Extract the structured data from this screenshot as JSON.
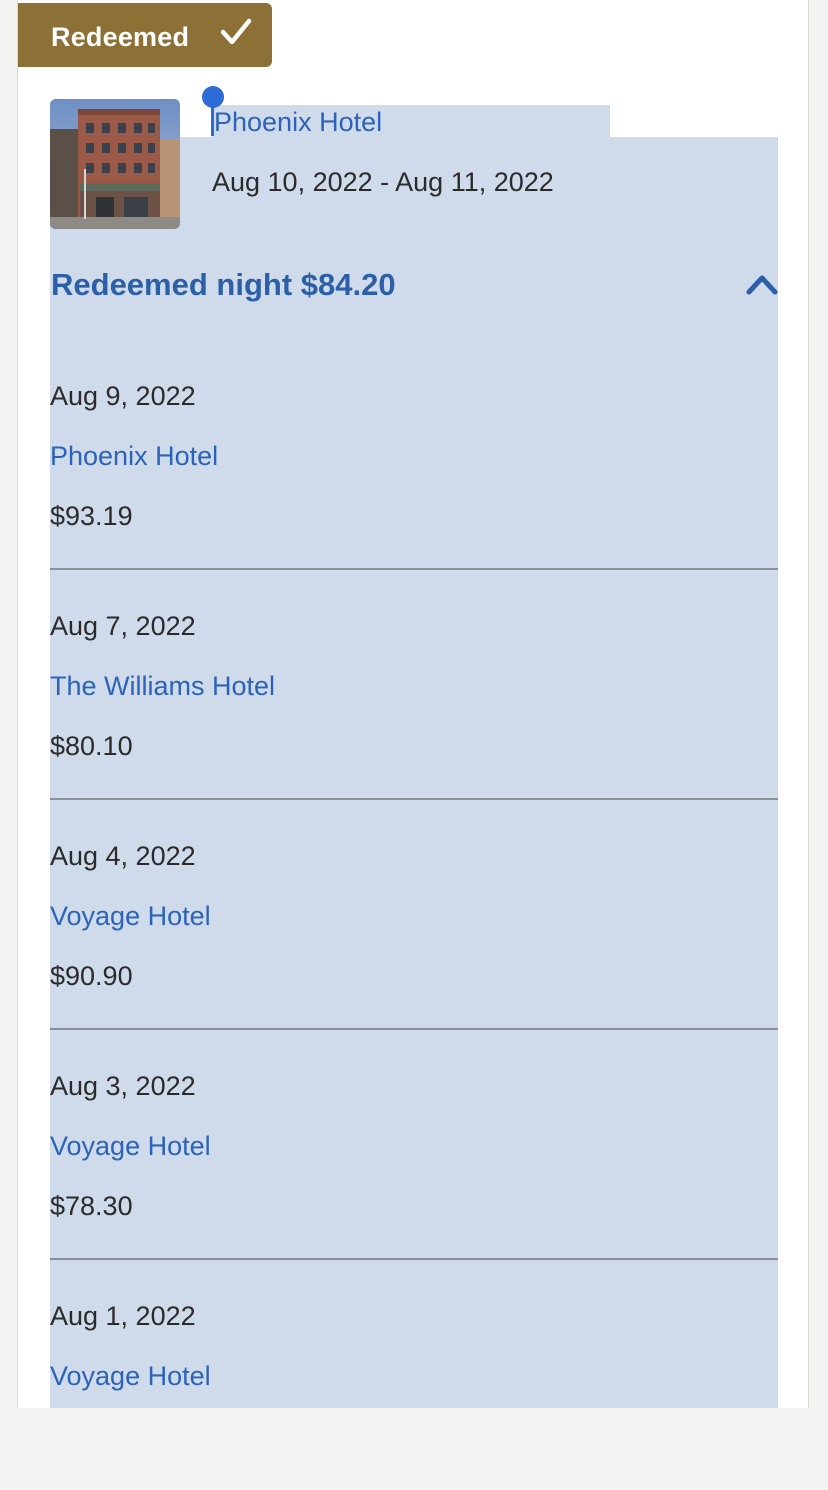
{
  "badge": {
    "label": "Redeemed",
    "icon": "check-icon",
    "color": "#8d7035"
  },
  "stay": {
    "hotel_name": "Phoenix Hotel",
    "dates": "Aug 10, 2022 - Aug 11, 2022",
    "thumbnail_icon": "hotel-photo"
  },
  "redeemed_summary": {
    "label": "Redeemed night $84.20",
    "toggle_icon": "chevron-up-icon"
  },
  "nights": [
    {
      "date": "Aug 9, 2022",
      "hotel": "Phoenix Hotel",
      "price": "$93.19"
    },
    {
      "date": "Aug 7, 2022",
      "hotel": "The Williams Hotel",
      "price": "$80.10"
    },
    {
      "date": "Aug 4, 2022",
      "hotel": "Voyage Hotel",
      "price": "$90.90"
    },
    {
      "date": "Aug 3, 2022",
      "hotel": "Voyage Hotel",
      "price": "$78.30"
    },
    {
      "date": "Aug 1, 2022",
      "hotel": "Voyage Hotel",
      "price": ""
    }
  ],
  "colors": {
    "link": "#2b63b8",
    "selection": "#cfdbeb",
    "text": "#2b2b2b"
  }
}
